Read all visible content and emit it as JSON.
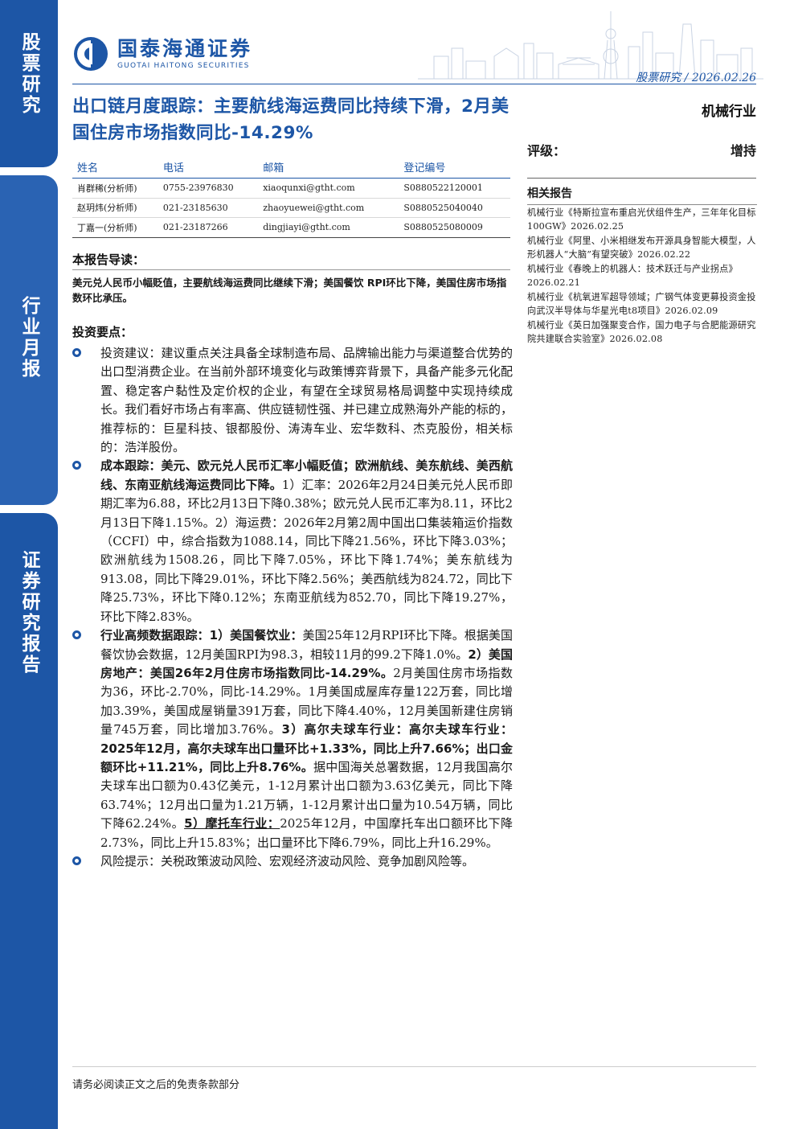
{
  "sidebar": {
    "label1": "股票研究",
    "label2": "行业月报",
    "label3": "证券研究报告"
  },
  "header": {
    "brand_cn": "国泰海通证券",
    "brand_en": "GUOTAI HAITONG SECURITIES",
    "meta": "股票研究 / 2026.02.26",
    "brand_color": "#1d56a6"
  },
  "title": "出口链月度跟踪：主要航线海运费同比持续下滑，2月美国住房市场指数同比-14.29%",
  "industry": "机械行业",
  "rating": {
    "label": "评级：",
    "value": "增持"
  },
  "analysts": {
    "headers": [
      "姓名",
      "电话",
      "邮箱",
      "登记编号"
    ],
    "rows": [
      [
        "肖群稀(分析师)",
        "0755-23976830",
        "xiaoqunxi@gtht.com",
        "S0880522120001"
      ],
      [
        "赵玥炜(分析师)",
        "021-23185630",
        "zhaoyuewei@gtht.com",
        "S0880525040040"
      ],
      [
        "丁嘉一(分析师)",
        "021-23187266",
        "dingjiayi@gtht.com",
        "S0880525080009"
      ]
    ]
  },
  "related": {
    "heading": "相关报告",
    "items": [
      "机械行业《特斯拉宣布重启光伏组件生产，三年年化目标100GW》2026.02.25",
      "机械行业《阿里、小米相继发布开源具身智能大模型，人形机器人“大脑”有望突破》2026.02.22",
      "机械行业《春晚上的机器人：技术跃迁与产业拐点》2026.02.21",
      "机械行业《杭氧进军超导领域；广钢气体变更募投资金投向武汉半导体与华星光电t8项目》2026.02.09",
      "机械行业《英日加强聚变合作，国力电子与合肥能源研究院共建联合实验室》2026.02.08"
    ]
  },
  "guide": {
    "heading": "本报告导读：",
    "text": "美元兑人民币小幅贬值，主要航线海运费同比继续下滑；美国餐饮 RPI环比下降，美国住房市场指数环比承压。"
  },
  "points": {
    "heading": "投资要点：",
    "p1": "投资建议：建议重点关注具备全球制造布局、品牌输出能力与渠道整合优势的出口型消费企业。在当前外部环境变化与政策博弈背景下，具备产能多元化配置、稳定客户黏性及定价权的企业，有望在全球贸易格局调整中实现持续成长。我们看好市场占有率高、供应链韧性强、并已建立成熟海外产能的标的，推荐标的：巨星科技、银都股份、涛涛车业、宏华数科、杰克股份，相关标的：浩洋股份。",
    "p2_bold": "成本跟踪：美元、欧元兑人民币汇率小幅贬值；欧洲航线、美东航线、美西航线、东南亚航线海运费同比下降。",
    "p2_text": "1）汇率：2026年2月24日美元兑人民币即期汇率为6.88，环比2月13日下降0.38%；欧元兑人民币汇率为8.11，环比2月13日下降1.15%。2）海运费：2026年2月第2周中国出口集装箱运价指数（CCFI）中，综合指数为1088.14，同比下降21.56%，环比下降3.03%；欧洲航线为1508.26，同比下降7.05%，环比下降1.74%；美东航线为913.08，同比下降29.01%，环比下降2.56%；美西航线为824.72，同比下降25.73%，环比下降0.12%；东南亚航线为852.70，同比下降19.27%，环比下降2.83%。",
    "p3_b1": "行业高频数据跟踪：1）美国餐饮业：",
    "p3_t1": "美国25年12月RPI环比下降。根据美国餐饮协会数据，12月美国RPI为98.3，相较11月的99.2下降1.0%。",
    "p3_b2": "2）美国房地产：美国26年2月住房市场指数同比-14.29%。",
    "p3_t2": "2月美国住房市场指数为36，环比-2.70%，同比-14.29%。1月美国成屋库存量122万套，同比增加3.39%，美国成屋销量391万套，同比下降4.40%，12月美国新建住房销量745万套，同比增加3.76%。",
    "p3_b3": "3）高尔夫球车行业：高尔夫球车行业：2025年12月，高尔夫球车出口量环比+1.33%，同比上升7.66%；出口金额环比+11.21%，同比上升8.76%。",
    "p3_t3": "据中国海关总署数据，12月我国高尔夫球车出口额为0.43亿美元，1-12月累计出口额为3.63亿美元，同比下降63.74%；12月出口量为1.21万辆，1-12月累计出口量为10.54万辆，同比下降62.24%。",
    "p3_b4": "5）摩托车行业：",
    "p3_t4": "2025年12月，中国摩托车出口额环比下降2.73%，同比上升15.83%；出口量环比下降6.79%，同比上升16.29%。",
    "p4": "风险提示：关税政策波动风险、宏观经济波动风险、竞争加剧风险等。"
  },
  "footer": "请务必阅读正文之后的免责条款部分"
}
